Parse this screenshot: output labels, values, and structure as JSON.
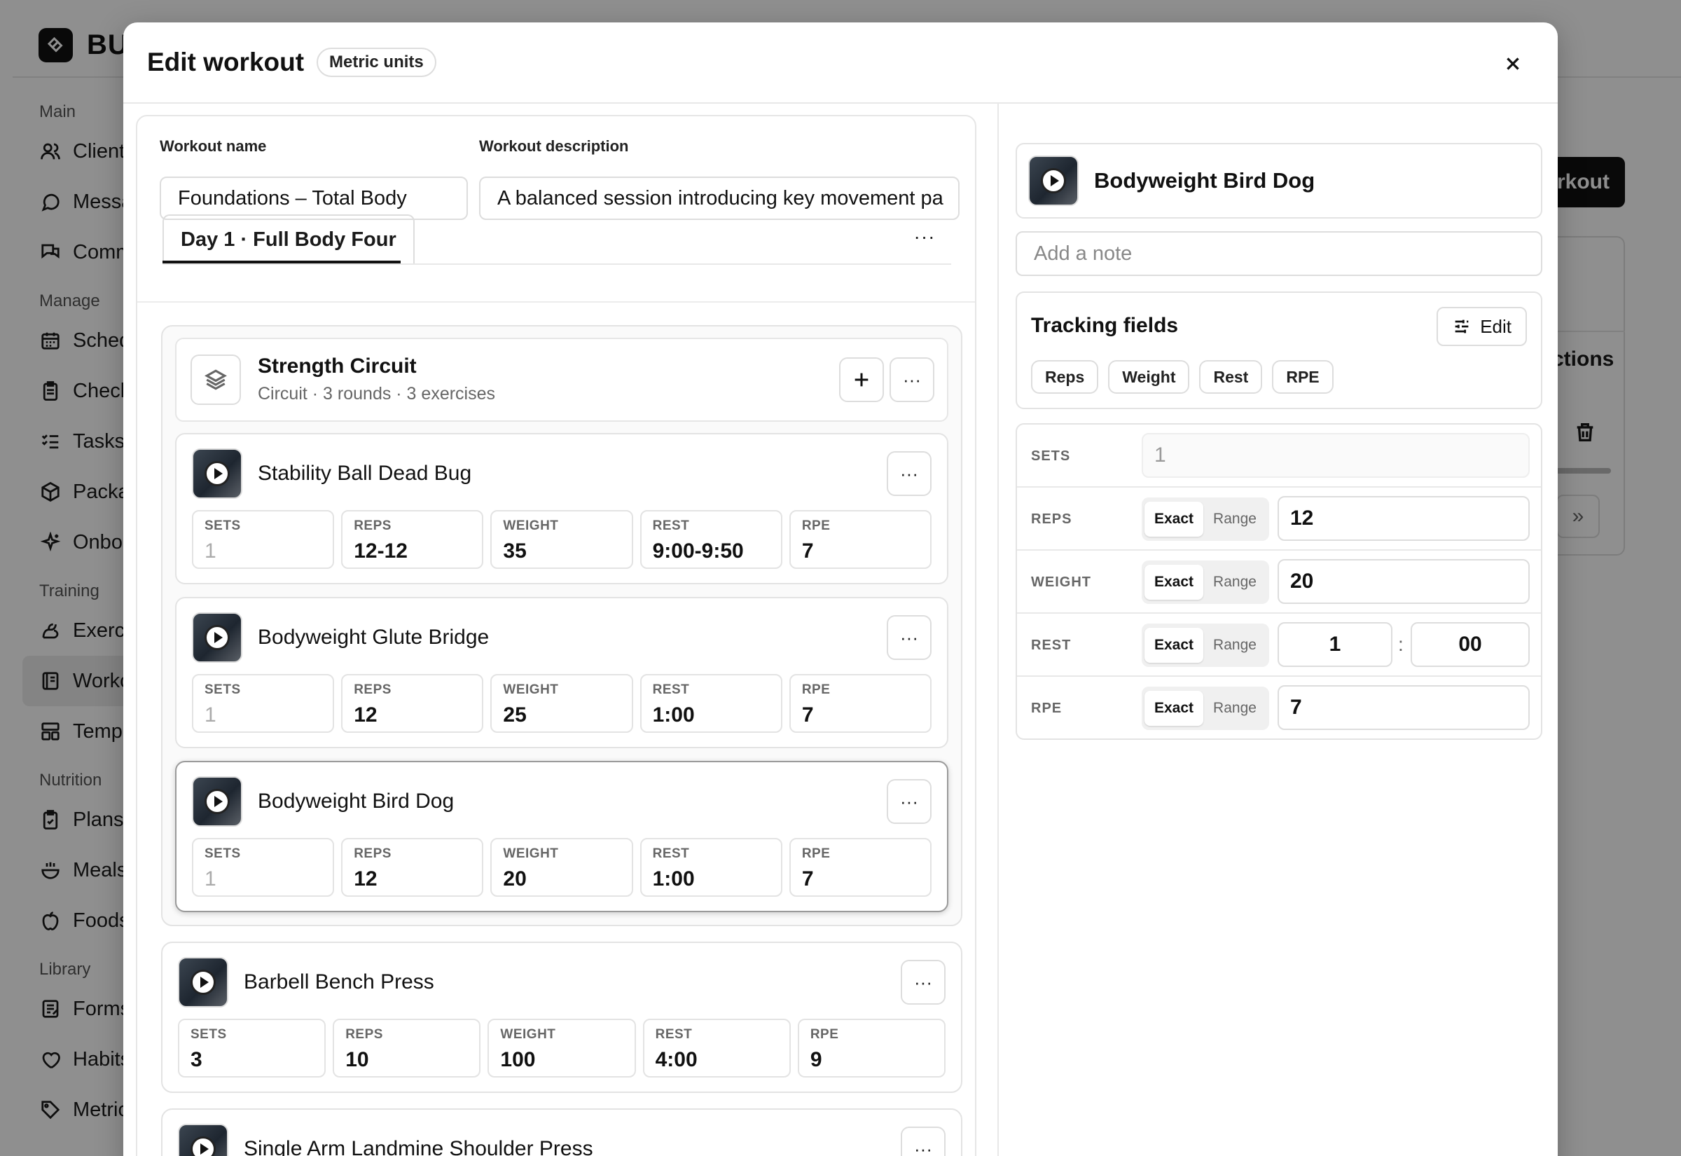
{
  "background": {
    "brand_name": "BU",
    "nav": [
      {
        "section": "Main",
        "items": [
          {
            "icon": "users-icon",
            "label": "Client"
          },
          {
            "icon": "message-icon",
            "label": "Messa"
          },
          {
            "icon": "community-icon",
            "label": "Comm"
          }
        ]
      },
      {
        "section": "Manage",
        "items": [
          {
            "icon": "calendar-icon",
            "label": "Sched"
          },
          {
            "icon": "clipboard-icon",
            "label": "Check"
          },
          {
            "icon": "checklist-icon",
            "label": "Tasks"
          },
          {
            "icon": "package-icon",
            "label": "Packa"
          },
          {
            "icon": "sparkle-icon",
            "label": "Onbo"
          }
        ]
      },
      {
        "section": "Training",
        "items": [
          {
            "icon": "arm-icon",
            "label": "Exerc"
          },
          {
            "icon": "book-icon",
            "label": "Worko",
            "active": true
          },
          {
            "icon": "template-icon",
            "label": "Temp"
          }
        ]
      },
      {
        "section": "Nutrition",
        "items": [
          {
            "icon": "clipboard-check-icon",
            "label": "Plans"
          },
          {
            "icon": "bowl-icon",
            "label": "Meals"
          },
          {
            "icon": "apple-icon",
            "label": "Foods"
          }
        ]
      },
      {
        "section": "Library",
        "items": [
          {
            "icon": "form-icon",
            "label": "Forms"
          },
          {
            "icon": "heart-icon",
            "label": "Habits"
          },
          {
            "icon": "tag-icon",
            "label": "Metric"
          }
        ]
      }
    ],
    "header_button": "rkout",
    "column_text": "ctions",
    "pager_glyph": "»"
  },
  "modal": {
    "title": "Edit workout",
    "badge": "Metric units",
    "workout_name_label": "Workout name",
    "workout_name": "Foundations – Total Body",
    "workout_description_label": "Workout description",
    "workout_description": "A balanced session introducing key movement pa",
    "day_tab": "Day 1 · Full Body Four",
    "more_glyph": "···",
    "circuit": {
      "title": "Strength Circuit",
      "meta": "Circuit · 3 rounds · 3 exercises",
      "exercises": [
        {
          "name": "Stability Ball Dead Bug",
          "sets": "1",
          "reps": "12-12",
          "weight": "35",
          "rest": "9:00-9:50",
          "rpe": "7"
        },
        {
          "name": "Bodyweight Glute Bridge",
          "sets": "1",
          "reps": "12",
          "weight": "25",
          "rest": "1:00",
          "rpe": "7"
        },
        {
          "name": "Bodyweight Bird Dog",
          "sets": "1",
          "reps": "12",
          "weight": "20",
          "rest": "1:00",
          "rpe": "7",
          "selected": true
        }
      ]
    },
    "exercises": [
      {
        "name": "Barbell Bench Press",
        "sets": "3",
        "reps": "10",
        "weight": "100",
        "rest": "4:00",
        "rpe": "9"
      },
      {
        "name": "Single Arm Landmine Shoulder Press"
      }
    ],
    "field_labels": {
      "sets": "SETS",
      "reps": "REPS",
      "weight": "WEIGHT",
      "rest": "REST",
      "rpe": "RPE"
    }
  },
  "detail": {
    "exercise_name": "Bodyweight Bird Dog",
    "note_placeholder": "Add a note",
    "tracking_title": "Tracking fields",
    "edit_label": "Edit",
    "chips": [
      "Reps",
      "Weight",
      "Rest",
      "RPE"
    ],
    "seg_exact": "Exact",
    "seg_range": "Range",
    "rows": {
      "sets": {
        "label": "SETS",
        "value": "1"
      },
      "reps": {
        "label": "REPS",
        "value": "12"
      },
      "weight": {
        "label": "WEIGHT",
        "value": "20"
      },
      "rest": {
        "label": "REST",
        "minutes": "1",
        "seconds": "00",
        "separator": ":"
      },
      "rpe": {
        "label": "RPE",
        "value": "7"
      }
    }
  }
}
